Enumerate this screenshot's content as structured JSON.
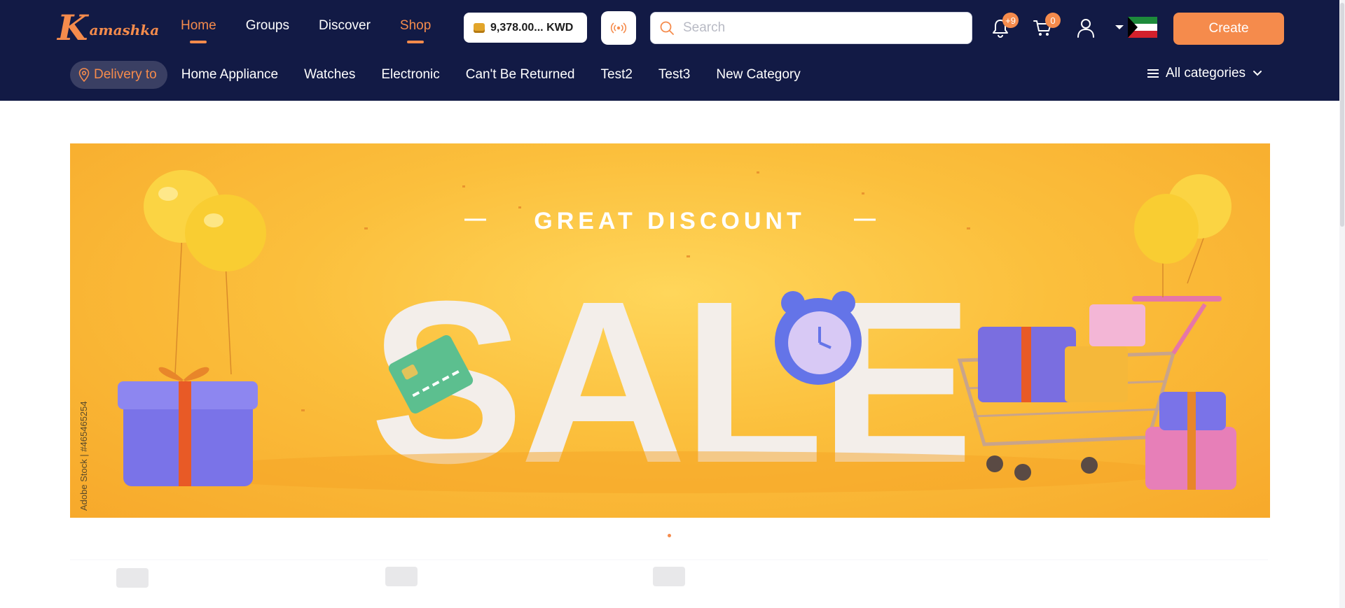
{
  "brand": {
    "logo_k": "K",
    "logo_rest": "amashka"
  },
  "nav": {
    "items": [
      {
        "label": "Home",
        "active": true
      },
      {
        "label": "Groups",
        "active": false
      },
      {
        "label": "Discover",
        "active": false
      },
      {
        "label": "Shop",
        "active": true
      }
    ]
  },
  "wallet": {
    "balance": "9,378.00... KWD"
  },
  "search": {
    "placeholder": "Search",
    "value": ""
  },
  "notifications": {
    "count": "+9"
  },
  "cart": {
    "count": "0"
  },
  "create_label": "Create",
  "subnav": {
    "delivery_label": "Delivery to",
    "categories": [
      "Home Appliance",
      "Watches",
      "Electronic",
      "Can't Be Returned",
      "Test2",
      "Test3",
      "New Category"
    ],
    "all_categories_label": "All categories"
  },
  "banner": {
    "headline": "GREAT DISCOUNT",
    "big_word": "SALE",
    "stock_credit": "Adobe Stock | #465465254"
  },
  "colors": {
    "header_bg": "#121a45",
    "accent": "#f58b4c",
    "banner_yellow": "#fbbf3c"
  },
  "icons": [
    "coin-icon",
    "live-broadcast-icon",
    "search-icon",
    "bell-icon",
    "cart-icon",
    "user-icon",
    "caret-down-icon",
    "kuwait-flag-icon",
    "location-pin-icon",
    "menu-icon",
    "chevron-down-icon"
  ]
}
